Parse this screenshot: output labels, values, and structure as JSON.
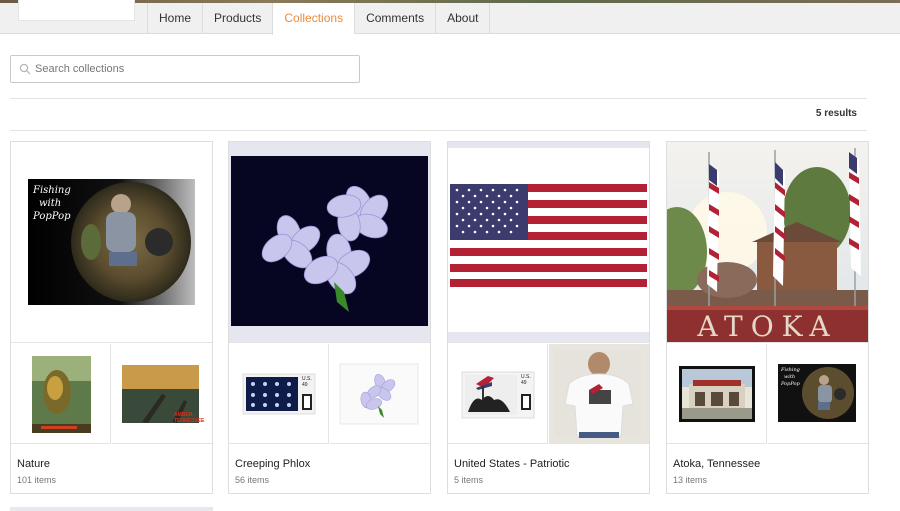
{
  "nav": {
    "tabs": [
      {
        "label": "Home"
      },
      {
        "label": "Products"
      },
      {
        "label": "Collections"
      },
      {
        "label": "Comments"
      },
      {
        "label": "About"
      }
    ],
    "active_tab": "Collections",
    "active_color": "#ec8b3d"
  },
  "search": {
    "placeholder": "Search collections",
    "value": ""
  },
  "results": {
    "label": "5 results"
  },
  "collections": [
    {
      "name": "Nature",
      "count": "101 items",
      "hero_text_line1": "Fishing",
      "hero_text_line2": "with",
      "hero_text_line3": "PopPop",
      "thumb_right_text": "AMBER, TENNESSEE"
    },
    {
      "name": "Creeping Phlox",
      "count": "56 items",
      "stamp_text": "U.S. 49"
    },
    {
      "name": "United States - Patriotic",
      "count": "5 items",
      "stamp_text": "U.S. 49"
    },
    {
      "name": "Atoka, Tennessee",
      "count": "13 items",
      "hero_sign": "ATOKA",
      "thumb_right_text_line1": "Fishing",
      "thumb_right_text_line2": "with",
      "thumb_right_text_line3": "PopPop"
    }
  ]
}
